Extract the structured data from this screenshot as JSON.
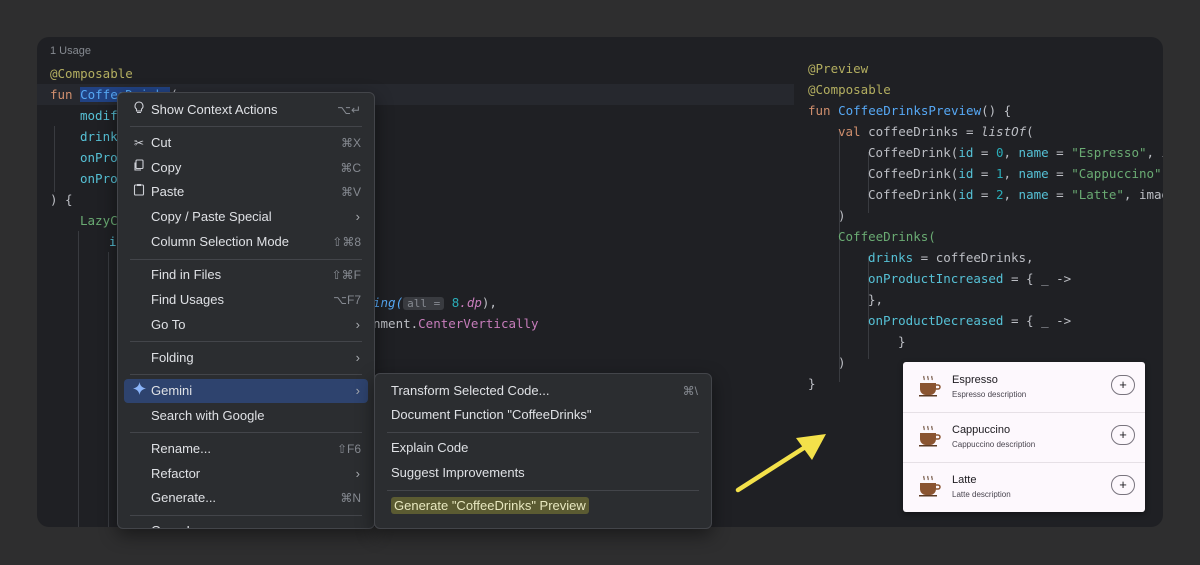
{
  "editor": {
    "usage_hint": "1 Usage",
    "left_code": {
      "l0": "@Composable",
      "l1_kw": "fun ",
      "l1_fn": "CoffeeDrinks",
      "l1_rest": "(",
      "l2": "modif",
      "l3": "drink",
      "l4": "onPro",
      "l5": "onPro",
      "l6": ") {",
      "l7": "LazyC",
      "l8": "i",
      "l9_fn": "ing(",
      "l9_hint": "all =",
      "l9_num": "8",
      "l9_dp": ".dp",
      "l9_end": "),",
      "l10_a": "nment.",
      "l10_b": "CenterVertically"
    },
    "right_code": {
      "r0": "@Preview",
      "r1": "@Composable",
      "r2_kw": "fun ",
      "r2_fn": "CoffeeDrinksPreview",
      "r2_rest": "() {",
      "r3_kw": "val ",
      "r3_var": "coffeeDrinks",
      "r3_eq": " = ",
      "r3_fn": "listOf",
      "r3_end": "(",
      "r4_a": "CoffeeDrink(",
      "r4_id": "id",
      "r4_b": " = ",
      "r4_n0": "0",
      "r4_c": ", ",
      "r4_name": "name",
      "r4_d": " = ",
      "r4_s": "\"Espresso\"",
      "r4_e": ", i",
      "r5_n": "1",
      "r5_s": "\"Cappuccino\"",
      "r5_e": ",",
      "r6_n": "2",
      "r6_s": "\"Latte\"",
      "r6_e": ", imag",
      "r7": ")",
      "r8": "CoffeeDrinks(",
      "r9_p": "drinks",
      "r9_rest": " = coffeeDrinks,",
      "r10_p": "onProductIncreased",
      "r10_rest": " = { _ ->",
      "r11": "},",
      "r12_p": "onProductDecreased",
      "r12_rest": " = { _ ->",
      "r13": "}",
      "r14": ")",
      "r15": "}"
    }
  },
  "context_menu": {
    "items": [
      {
        "label": "Show Context Actions",
        "shortcut": "⌥↵"
      },
      {
        "label": "Cut",
        "shortcut": "⌘X"
      },
      {
        "label": "Copy",
        "shortcut": "⌘C"
      },
      {
        "label": "Paste",
        "shortcut": "⌘V"
      },
      {
        "label": "Copy / Paste Special"
      },
      {
        "label": "Column Selection Mode",
        "shortcut": "⇧⌘8"
      },
      {
        "label": "Find in Files",
        "shortcut": "⇧⌘F"
      },
      {
        "label": "Find Usages",
        "shortcut": "⌥F7"
      },
      {
        "label": "Go To"
      },
      {
        "label": "Folding"
      },
      {
        "label": "Gemini"
      },
      {
        "label": "Search with Google"
      },
      {
        "label": "Rename...",
        "shortcut": "⇧F6"
      },
      {
        "label": "Refactor"
      },
      {
        "label": "Generate...",
        "shortcut": "⌘N"
      },
      {
        "label": "Open In"
      }
    ]
  },
  "gemini_submenu": {
    "items": [
      {
        "label": "Transform Selected Code...",
        "shortcut": "⌘\\"
      },
      {
        "label": "Document Function \"CoffeeDrinks\""
      },
      {
        "label": "Explain Code"
      },
      {
        "label": "Suggest Improvements"
      },
      {
        "label": "Generate \"CoffeeDrinks\" Preview"
      }
    ]
  },
  "preview_panel": {
    "items": [
      {
        "name": "Espresso",
        "description": "Espresso description"
      },
      {
        "name": "Cappuccino",
        "description": "Cappuccino description"
      },
      {
        "name": "Latte",
        "description": "Latte description"
      }
    ],
    "plus_label": "+"
  },
  "colors": {
    "background": "#2e2e2f",
    "editor_bg": "#1f2024",
    "menu_bg": "#2b2d30",
    "menu_active": "#2e436e",
    "highlight": "#5b5b32",
    "arrow": "#f3e14a",
    "preview_bg": "#fdf8fd"
  }
}
